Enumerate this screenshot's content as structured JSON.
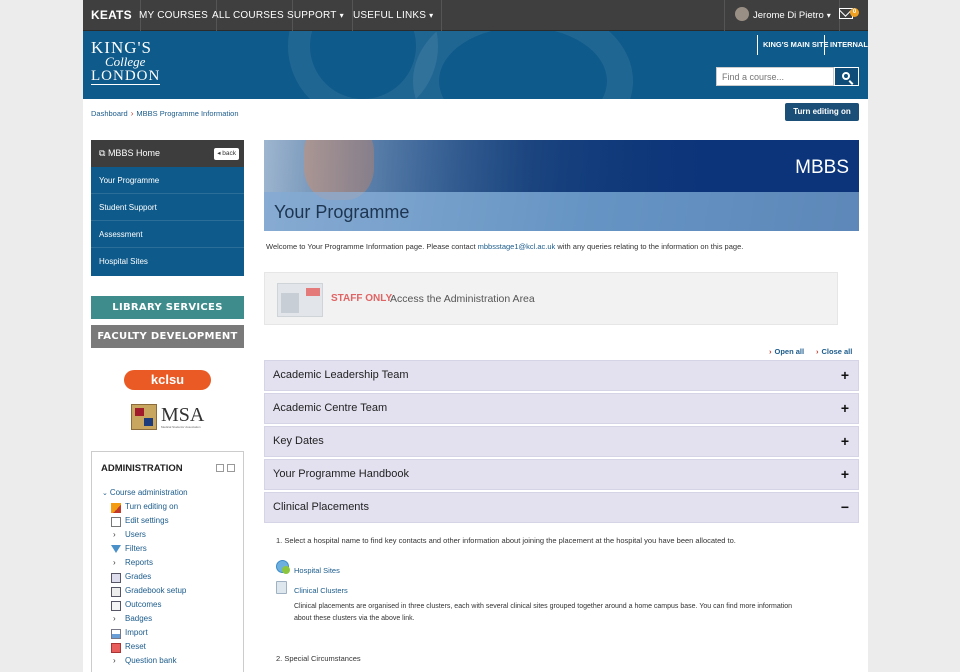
{
  "topnav": {
    "brand": "KEATS",
    "items": [
      "MY COURSES",
      "ALL COURSES",
      "SUPPORT",
      "USEFUL LINKS"
    ],
    "user": "Jerome Di Pietro",
    "mail_count": "0"
  },
  "header": {
    "logo_line1": "KING'S",
    "logo_line2": "College",
    "logo_line3": "LONDON",
    "main_site": "KING'S MAIN SITE",
    "internal": "INTERNAL",
    "search_placeholder": "Find a course..."
  },
  "breadcrumb": {
    "items": [
      "Dashboard",
      "MBBS Programme Information"
    ],
    "separator": "›"
  },
  "edit_button": "Turn editing on",
  "leftnav": {
    "title": "MBBS Home",
    "back": "back",
    "links": [
      "Your Programme",
      "Student Support",
      "Assessment",
      "Hospital Sites"
    ]
  },
  "promos": {
    "library": "LIBRARY SERVICES",
    "faculty": "FACULTY DEVELOPMENT",
    "library_color": "#3e8c8c",
    "faculty_color": "#7a7a7a"
  },
  "logos": {
    "kclsu": "kclsu",
    "msa": "MSA",
    "msa_sub": "Medical Students' Association"
  },
  "admin": {
    "title": "ADMINISTRATION",
    "course_admin": "Course administration",
    "items": [
      "Turn editing on",
      "Edit settings",
      "Users",
      "Filters",
      "Reports",
      "Grades",
      "Gradebook setup",
      "Outcomes",
      "Badges",
      "Import",
      "Reset",
      "Question bank"
    ]
  },
  "banner": {
    "tag": "MBBS",
    "title": "Your Programme"
  },
  "welcome": {
    "before": "Welcome to Your Programme Information page.  Please contact ",
    "email": "mbbsstage1@kcl.ac.uk",
    "after": " with any queries relating to the information on this page."
  },
  "staff_only": {
    "label": "STAFF ONLY",
    "text": "Access the Administration Area"
  },
  "accordion_controls": {
    "open_all": "Open all",
    "close_all": "Close all"
  },
  "accordion": [
    {
      "label": "Academic Leadership Team",
      "sign": "+"
    },
    {
      "label": "Academic Centre Team",
      "sign": "+"
    },
    {
      "label": "Key Dates",
      "sign": "+"
    },
    {
      "label": "Your Programme Handbook",
      "sign": "+"
    },
    {
      "label": "Clinical Placements",
      "sign": "−"
    }
  ],
  "placements": {
    "step1": "1. Select a hospital name to find key contacts and other information about joining the placement at the hospital you have been allocated to.",
    "hospital_sites": "Hospital Sites",
    "clinical_clusters": "Clinical Clusters",
    "desc_line1": "Clinical placements are organised in three clusters, each with several clinical sites grouped together around a home campus base. You can find more information",
    "desc_line2": "about these clusters via the above link.",
    "step2": "2. Special Circumstances"
  }
}
